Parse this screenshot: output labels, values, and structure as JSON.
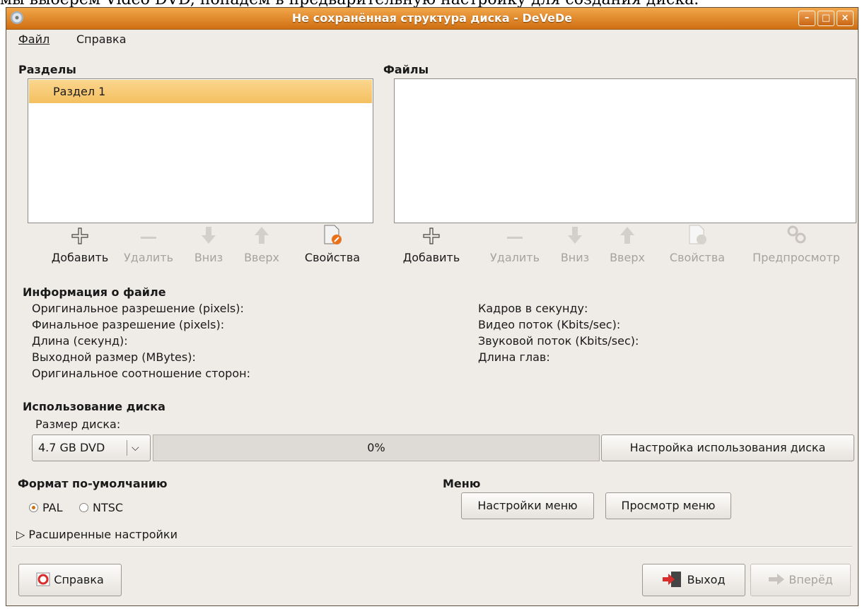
{
  "caption_text": "мы выберем Video DVD, попадем в предварительную настройку для создания диска.",
  "window": {
    "title": "Не сохранённая структура диска - DeVeDe",
    "buttons": {
      "minimize": "–",
      "maximize": "□",
      "close": "×"
    }
  },
  "menu": {
    "file": "Файл",
    "help": "Справка"
  },
  "sections": {
    "title": "Разделы",
    "items": [
      "Раздел 1"
    ],
    "toolbar": {
      "add": "Добавить",
      "remove": "Удалить",
      "down": "Вниз",
      "up": "Вверх",
      "properties": "Свойства"
    }
  },
  "files": {
    "title": "Файлы",
    "toolbar": {
      "add": "Добавить",
      "remove": "Удалить",
      "down": "Вниз",
      "up": "Вверх",
      "properties": "Свойства",
      "preview": "Предпросмотр"
    }
  },
  "file_info": {
    "title": "Информация о файле",
    "left": [
      "Оригинальное разрешение (pixels):",
      "Финальное разрешение (pixels):",
      "Длина (секунд):",
      "Выходной размер (MBytes):",
      "Оригинальное соотношение сторон:"
    ],
    "right": [
      "Кадров в секунду:",
      "Видео поток (Kbits/sec):",
      "Звуковой поток (Kbits/sec):",
      "Длина глав:"
    ]
  },
  "disk_usage": {
    "title": "Использование диска",
    "size_label": "Размер диска:",
    "size_value": "4.7 GB DVD",
    "progress_text": "0%",
    "progress_fraction": 0,
    "settings_button": "Настройка использования диска"
  },
  "default_format": {
    "title": "Формат по-умолчанию",
    "pal": "PAL",
    "ntsc": "NTSC",
    "selected": "PAL"
  },
  "menu_section": {
    "title": "Меню",
    "settings_button": "Настройки меню",
    "preview_button": "Просмотр меню"
  },
  "advanced": {
    "label": "Расширенные настройки"
  },
  "bottom": {
    "help": "Справка",
    "exit": "Выход",
    "forward": "Вперёд"
  },
  "colors": {
    "titlebar": "#e88a2e",
    "selection": "#f7c96e",
    "window_bg": "#efebe7",
    "exit_icon": "#d92c2c"
  }
}
